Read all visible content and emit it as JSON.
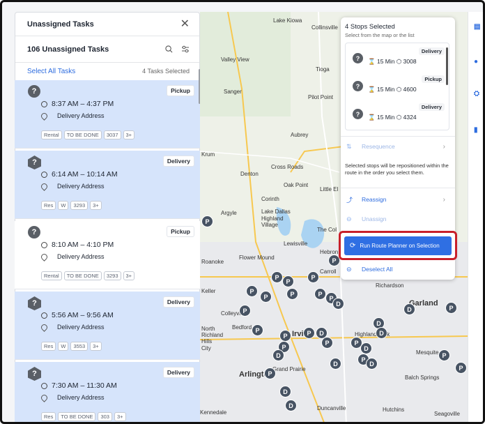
{
  "left_panel": {
    "title": "Unassigned Tasks",
    "count_label": "106 Unassigned Tasks",
    "select_all": "Select All Tasks",
    "selected_count": "4 Tasks Selected",
    "tasks": [
      {
        "avatar": "?",
        "tag": "Pickup",
        "time": "8:37 AM – 4:37 PM",
        "address": "Delivery Address",
        "chips": [
          "Rental",
          "TO BE DONE",
          "3037",
          "3+"
        ],
        "selected": true
      },
      {
        "avatar": "?",
        "tag": "Delivery",
        "time": "6:14 AM – 10:14 AM",
        "address": "Delivery Address",
        "chips": [
          "Res",
          "W",
          "3293",
          "3+"
        ],
        "selected": true
      },
      {
        "avatar": "?",
        "tag": "Pickup",
        "time": "8:10 AM – 4:10 PM",
        "address": "Delivery Address",
        "chips": [
          "Rental",
          "TO BE DONE",
          "3293",
          "3+"
        ],
        "selected": false
      },
      {
        "avatar": "?",
        "tag": "Delivery",
        "time": "5:56 AM – 9:56 AM",
        "address": "Delivery Address",
        "chips": [
          "Res",
          "W",
          "3553",
          "3+"
        ],
        "selected": true
      },
      {
        "avatar": "?",
        "tag": "Delivery",
        "time": "7:30 AM – 11:30 AM",
        "address": "Delivery Address",
        "chips": [
          "Res",
          "TO BE DONE",
          "303",
          "3+"
        ],
        "selected": true
      }
    ]
  },
  "popover": {
    "title": "4 Stops Selected",
    "subtitle": "Select from the map or the list",
    "stops": [
      {
        "avatar": "?",
        "tag": "Delivery",
        "meta": "15 Min",
        "number": "3008"
      },
      {
        "avatar": "?",
        "tag": "Pickup",
        "meta": "15 Min",
        "number": "4600"
      },
      {
        "avatar": "?",
        "tag": "Delivery",
        "meta": "15 Min",
        "number": "4324"
      }
    ],
    "resequence": "Resequence",
    "note": "Selected stops will be repositioned within the route in the order you select them.",
    "reassign": "Reassign",
    "unassign": "Unassign",
    "run_planner": "Run Route Planner on Selection",
    "deselect_all": "Deselect All"
  },
  "map": {
    "labels": [
      "Lake Kiowa",
      "Collinsville",
      "Valley View",
      "Tioga",
      "Pilot Point",
      "Sanger",
      "Aubrey",
      "Krum",
      "Denton",
      "Cross Roads",
      "Oak Point",
      "Little El",
      "Corinth",
      "Argyle",
      "Lake Dallas",
      "Highland Village",
      "The Col",
      "Lewisville",
      "Hebron",
      "Flower Mound",
      "Roanoke",
      "Carroll",
      "Keller",
      "Colleyville",
      "Bedford",
      "North Richland Hills",
      "Irving",
      "Highland Park",
      "Arlington",
      "Grand Prairie",
      "Duncanville",
      "Hutchins",
      "Balch Springs",
      "Mesquite",
      "Seagoville",
      "Kennedale",
      "Richardson",
      "Garland",
      "City"
    ]
  }
}
